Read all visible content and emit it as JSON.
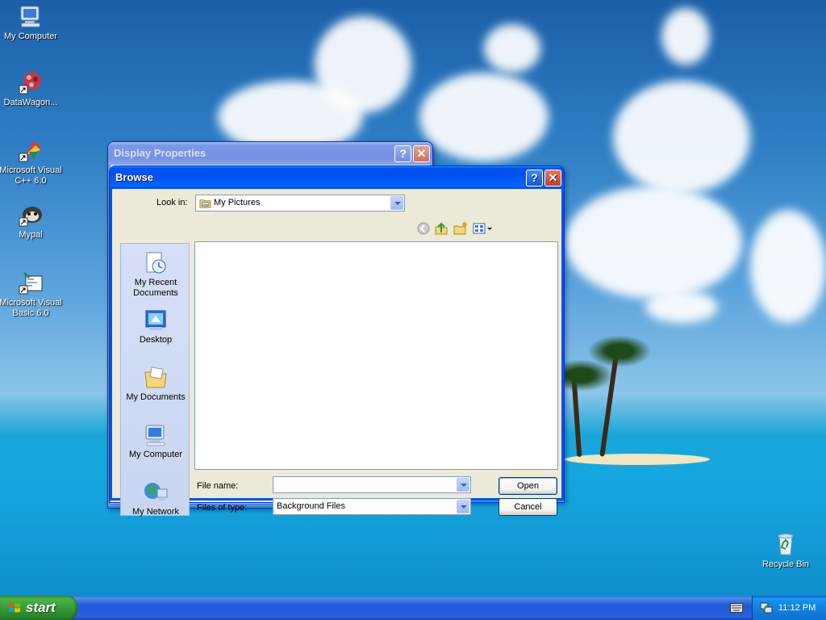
{
  "desktop": {
    "icons": [
      {
        "label": "My Computer",
        "icon": "my-computer-icon"
      },
      {
        "label": "DataWagon...",
        "icon": "datawagon-shortcut-icon"
      },
      {
        "label": "Microsoft Visual C++ 6.0",
        "icon": "visual-cpp-shortcut-icon"
      },
      {
        "label": "Mypal",
        "icon": "mypal-shortcut-icon"
      },
      {
        "label": "Microsoft Visual Basic 6.0",
        "icon": "visual-basic-shortcut-icon"
      },
      {
        "label": "Recycle Bin",
        "icon": "recycle-bin-icon"
      }
    ]
  },
  "display_properties": {
    "title": "Display Properties",
    "help_glyph": "?",
    "close_glyph": "✕"
  },
  "browse": {
    "title": "Browse",
    "help_glyph": "?",
    "close_glyph": "✕",
    "look_in_label": "Look in:",
    "look_in_value": "My Pictures",
    "places": [
      {
        "label": "My Recent Documents",
        "icon": "recent-documents-icon"
      },
      {
        "label": "Desktop",
        "icon": "desktop-icon"
      },
      {
        "label": "My Documents",
        "icon": "my-documents-icon"
      },
      {
        "label": "My Computer",
        "icon": "my-computer-icon"
      },
      {
        "label": "My Network",
        "icon": "my-network-icon"
      }
    ],
    "file_name_label": "File name:",
    "file_name_value": "",
    "files_of_type_label": "Files of type:",
    "files_of_type_value": "Background Files",
    "open_label": "Open",
    "cancel_label": "Cancel"
  },
  "taskbar": {
    "start_label": "start",
    "clock": "11:12 PM"
  },
  "colors": {
    "titlebar_active": "#0053ee",
    "start_green": "#3c9a3c",
    "dialog_face": "#ece9d8"
  }
}
